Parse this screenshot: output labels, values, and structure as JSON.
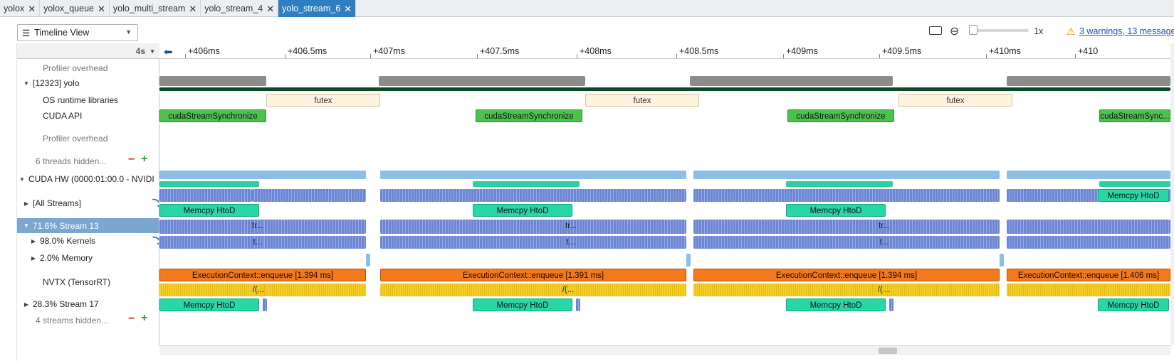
{
  "tabs": [
    {
      "label": "yolox",
      "active": false
    },
    {
      "label": "yolox_queue",
      "active": false
    },
    {
      "label": "yolo_multi_stream",
      "active": false
    },
    {
      "label": "yolo_stream_4",
      "active": false
    },
    {
      "label": "yolo_stream_6",
      "active": true
    }
  ],
  "toolbar": {
    "view_label": "Timeline View",
    "zoom_level": "1x",
    "warnings_link": "3 warnings, 13 messages"
  },
  "time_header": {
    "value": "4s"
  },
  "ruler_ticks": [
    "+406ms",
    "+406.5ms",
    "+407ms",
    "+407.5ms",
    "+408ms",
    "+408.5ms",
    "+409ms",
    "+409.5ms",
    "+410ms",
    "+410"
  ],
  "rows": {
    "profiler_overhead_1": "Profiler overhead",
    "process": "[12323] yolo",
    "os_runtime": "OS runtime libraries",
    "cuda_api": "CUDA API",
    "profiler_overhead_2": "Profiler overhead",
    "threads_hidden": "6 threads hidden...",
    "cuda_hw": "CUDA HW (0000:01:00.0 - NVIDI",
    "all_streams": "[All Streams]",
    "stream13": "71.6% Stream 13",
    "kernels": "98.0% Kernels",
    "memory": "2.0% Memory",
    "nvtx": "NVTX (TensorRT)",
    "stream17": "28.3% Stream 17",
    "streams_hidden": "4 streams hidden..."
  },
  "timeline": {
    "futex_label": "futex",
    "cuda_sync_label": "cudaStreamSynchronize",
    "cuda_sync_short": "cudaStreamSync...",
    "memcpy_label": "Memcpy HtoD",
    "tr_label": "tr...",
    "t_label": "t...",
    "slash_label": "/(...",
    "exec": [
      "ExecutionContext::enqueue [1.394 ms]",
      "ExecutionContext::enqueue [1.391 ms]",
      "ExecutionContext::enqueue [1.394 ms]",
      "ExecutionContext::enqueue [1.406 ms]"
    ]
  },
  "icons": {
    "menu": "menu-icon",
    "zoom": "zoom-out-icon",
    "keyboard": "keyboard-icon",
    "warning": "warning-icon"
  }
}
